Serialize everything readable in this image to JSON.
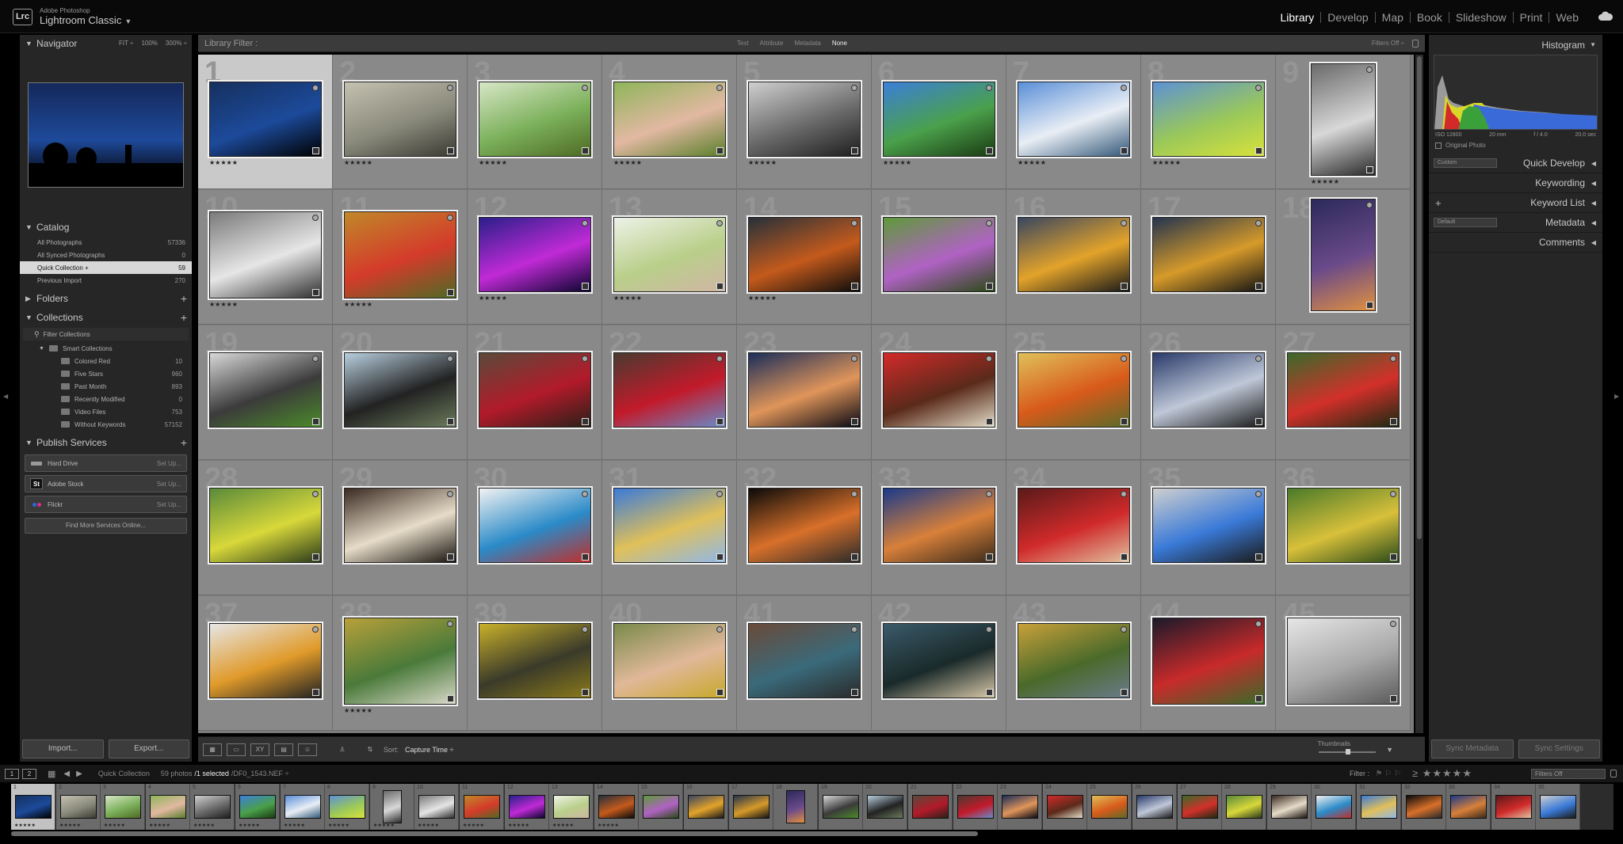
{
  "app": {
    "badge": "Lrc",
    "vendor": "Adobe Photoshop",
    "name": "Lightroom Classic",
    "modules": [
      {
        "label": "Library",
        "active": true
      },
      {
        "label": "Develop",
        "active": false
      },
      {
        "label": "Map",
        "active": false
      },
      {
        "label": "Book",
        "active": false
      },
      {
        "label": "Slideshow",
        "active": false
      },
      {
        "label": "Print",
        "active": false
      },
      {
        "label": "Web",
        "active": false
      }
    ]
  },
  "navigator": {
    "title": "Navigator",
    "fit": "FIT ÷",
    "p100": "100%",
    "p300": "300% ÷"
  },
  "catalog": {
    "title": "Catalog",
    "items": [
      {
        "label": "All Photographs",
        "count": "57336"
      },
      {
        "label": "All Synced Photographs",
        "count": "0"
      },
      {
        "label": "Quick Collection +",
        "count": "59",
        "selected": true
      },
      {
        "label": "Previous Import",
        "count": "270"
      }
    ]
  },
  "folders": {
    "title": "Folders"
  },
  "collections": {
    "title": "Collections",
    "filter": "Filter Collections",
    "smart": "Smart Collections",
    "items": [
      {
        "label": "Colored Red",
        "count": "10"
      },
      {
        "label": "Five Stars",
        "count": "960"
      },
      {
        "label": "Past Month",
        "count": "893"
      },
      {
        "label": "Recently Modified",
        "count": "0"
      },
      {
        "label": "Video Files",
        "count": "753"
      },
      {
        "label": "Without Keywords",
        "count": "57152"
      }
    ]
  },
  "publish": {
    "title": "Publish Services",
    "services": [
      {
        "label": "Hard Drive",
        "setup": "Set Up..."
      },
      {
        "label": "Adobe Stock",
        "setup": "Set Up...",
        "logo": "St"
      },
      {
        "label": "Flickr",
        "setup": "Set Up..."
      }
    ],
    "find_more": "Find More Services Online..."
  },
  "left_buttons": {
    "import": "Import...",
    "export": "Export..."
  },
  "filter_bar": {
    "title": "Library Filter :",
    "options": [
      {
        "label": "Text",
        "on": false
      },
      {
        "label": "Attribute",
        "on": false
      },
      {
        "label": "Metadata",
        "on": false
      },
      {
        "label": "None",
        "on": true
      }
    ],
    "filters_off": "Filters Off ÷"
  },
  "grid": {
    "cells": [
      {
        "num": "1",
        "stars": "★★★★★",
        "colors": [
          "#16305f",
          "#1c4a9a",
          "#000"
        ]
      },
      {
        "num": "2",
        "stars": "★★★★★",
        "colors": [
          "#c4c1b0",
          "#8a8a7c",
          "#3b3b33"
        ]
      },
      {
        "num": "3",
        "stars": "★★★★★",
        "colors": [
          "#d7e6c6",
          "#7bb05a",
          "#4e6a24"
        ]
      },
      {
        "num": "4",
        "stars": "★★★★★",
        "colors": [
          "#8fb55a",
          "#e2b8a2",
          "#5a7f2a"
        ]
      },
      {
        "num": "5",
        "stars": "★★★★★",
        "colors": [
          "#cfcfcf",
          "#6a6a6a",
          "#1e1e1e"
        ]
      },
      {
        "num": "6",
        "stars": "★★★★★",
        "colors": [
          "#3b7fd8",
          "#4aa04b",
          "#1a3b12"
        ]
      },
      {
        "num": "7",
        "stars": "★★★★★",
        "colors": [
          "#5a8fd8",
          "#e9eef5",
          "#335878"
        ]
      },
      {
        "num": "8",
        "stars": "★★★★★",
        "colors": [
          "#5d92d4",
          "#9ac85a",
          "#d8e23a"
        ]
      },
      {
        "num": "9",
        "stars": "★★★★★",
        "colors": [
          "#6a6a6a",
          "#d8d8d8",
          "#2a2a2a"
        ]
      },
      {
        "num": "10",
        "stars": "★★★★★",
        "colors": [
          "#7a7a7a",
          "#e6e6e6",
          "#303030"
        ]
      },
      {
        "num": "11",
        "stars": "★★★★★",
        "colors": [
          "#c0882a",
          "#d43b2a",
          "#4e6a24"
        ]
      },
      {
        "num": "12",
        "stars": "★★★★★",
        "colors": [
          "#2a1f8a",
          "#c02ad6",
          "#0c0630"
        ]
      },
      {
        "num": "13",
        "stars": "★★★★★",
        "colors": [
          "#eef2e8",
          "#b9cf8a",
          "#d0b6a4"
        ]
      },
      {
        "num": "14",
        "stars": "★★★★★",
        "colors": [
          "#26303a",
          "#c45a1c",
          "#0c0c0c"
        ]
      },
      {
        "num": "15",
        "stars": "",
        "colors": [
          "#5e9a3a",
          "#b062c4",
          "#2a4a16"
        ]
      },
      {
        "num": "16",
        "stars": "",
        "colors": [
          "#3a4660",
          "#e3a32a",
          "#1a1a1a"
        ]
      },
      {
        "num": "17",
        "stars": "",
        "colors": [
          "#24344e",
          "#d69a2a",
          "#141414"
        ]
      },
      {
        "num": "18",
        "stars": "",
        "colors": [
          "#2c2a5a",
          "#6a4a8a",
          "#e09040"
        ]
      },
      {
        "num": "19",
        "stars": "",
        "colors": [
          "#d8d8d8",
          "#3b3b3b",
          "#4b8a2a"
        ]
      },
      {
        "num": "20",
        "stars": "",
        "colors": [
          "#b8cfdf",
          "#222222",
          "#6a7a5a"
        ]
      },
      {
        "num": "21",
        "stars": "",
        "colors": [
          "#5a4a3a",
          "#b21a2a",
          "#2a2018"
        ]
      },
      {
        "num": "22",
        "stars": "",
        "colors": [
          "#4a3a30",
          "#c21a2a",
          "#6a8ac8"
        ]
      },
      {
        "num": "23",
        "stars": "",
        "colors": [
          "#1a2d5a",
          "#e0955a",
          "#0a0a14"
        ]
      },
      {
        "num": "24",
        "stars": "",
        "colors": [
          "#d22a2a",
          "#5a2a1a",
          "#e2dcc8"
        ]
      },
      {
        "num": "25",
        "stars": "",
        "colors": [
          "#e0c05a",
          "#d85a1a",
          "#5a6a2a"
        ]
      },
      {
        "num": "26",
        "stars": "",
        "colors": [
          "#2a3a6a",
          "#bfc8d8",
          "#1a1a1a"
        ]
      },
      {
        "num": "27",
        "stars": "",
        "colors": [
          "#3a6a2a",
          "#d2302a",
          "#1a2a12"
        ]
      },
      {
        "num": "28",
        "stars": "",
        "colors": [
          "#5a8a3a",
          "#d8d83a",
          "#2a3a1a"
        ]
      },
      {
        "num": "29",
        "stars": "",
        "colors": [
          "#3a2a22",
          "#e6dcc8",
          "#1a1410"
        ]
      },
      {
        "num": "30",
        "stars": "",
        "colors": [
          "#f2f2f2",
          "#2a8ac8",
          "#c0302a"
        ]
      },
      {
        "num": "31",
        "stars": "",
        "colors": [
          "#3a7ad8",
          "#e0c05a",
          "#90b8e8"
        ]
      },
      {
        "num": "32",
        "stars": "",
        "colors": [
          "#0a0a0a",
          "#d8702a",
          "#2a2a2a"
        ]
      },
      {
        "num": "33",
        "stars": "",
        "colors": [
          "#1a3a8a",
          "#d8803a",
          "#3a2a1a"
        ]
      },
      {
        "num": "34",
        "stars": "",
        "colors": [
          "#5a1a1a",
          "#d02a2a",
          "#e0c0a0"
        ]
      },
      {
        "num": "35",
        "stars": "",
        "colors": [
          "#cfcfcf",
          "#3a7ad8",
          "#1a1a1a"
        ]
      },
      {
        "num": "36",
        "stars": "",
        "colors": [
          "#4a7a2a",
          "#d8c03a",
          "#2a4a1a"
        ]
      },
      {
        "num": "37",
        "stars": "",
        "colors": [
          "#e6e6e6",
          "#e09a2a",
          "#222222"
        ]
      },
      {
        "num": "38",
        "stars": "★★★★★",
        "colors": [
          "#b8a03a",
          "#4a7a3a",
          "#d8d8c8"
        ]
      },
      {
        "num": "39",
        "stars": "",
        "colors": [
          "#c8b02a",
          "#3a3a2a",
          "#8a7a1a"
        ]
      },
      {
        "num": "40",
        "stars": "",
        "colors": [
          "#7a8a4a",
          "#e0b89a",
          "#c8a82a"
        ]
      },
      {
        "num": "41",
        "stars": "",
        "colors": [
          "#6a4a3a",
          "#3a6a7a",
          "#2a2a2a"
        ]
      },
      {
        "num": "42",
        "stars": "",
        "colors": [
          "#3a5a6a",
          "#1a2a2a",
          "#d8c8a8"
        ]
      },
      {
        "num": "43",
        "stars": "",
        "colors": [
          "#c8a03a",
          "#4a6a2a",
          "#6a7a8a"
        ]
      },
      {
        "num": "44",
        "stars": "",
        "colors": [
          "#1a1a2a",
          "#c82a2a",
          "#3a6a2a"
        ]
      },
      {
        "num": "45",
        "stars": "",
        "colors": [
          "#e6e6e6",
          "#a8a8a8",
          "#5a5a5a"
        ]
      }
    ]
  },
  "toolbar": {
    "sort_label": "Sort:",
    "sort_value": "Capture Time ÷",
    "thumbnails": "Thumbnails"
  },
  "right_panel": {
    "histogram": "Histogram",
    "hist_info": {
      "iso": "ISO 12800",
      "focal": "20 mm",
      "aperture": "f / 4.0",
      "shutter": "20.0 sec"
    },
    "original_photo": "Original Photo",
    "quick_develop": "Quick Develop",
    "qd_preset": "Custom",
    "keywording": "Keywording",
    "keyword_list": "Keyword List",
    "metadata": "Metadata",
    "md_preset": "Default",
    "comments": "Comments"
  },
  "right_buttons": {
    "sync_metadata": "Sync Metadata",
    "sync_settings": "Sync Settings"
  },
  "strip": {
    "page1": "1",
    "page2": "2",
    "source": "Quick Collection",
    "count": "59 photos",
    "selected": "/1 selected",
    "file": "/DF0_1543.NEF ÷",
    "filter": "Filter :",
    "rating": "≥ ★★★★★",
    "filters_off": "Filters Off"
  },
  "colors": {
    "accent": "#ffffff",
    "grid_bg": "#7b7b7b",
    "cell_bg": "#898989",
    "selected_cell": "#c9c9c9"
  }
}
